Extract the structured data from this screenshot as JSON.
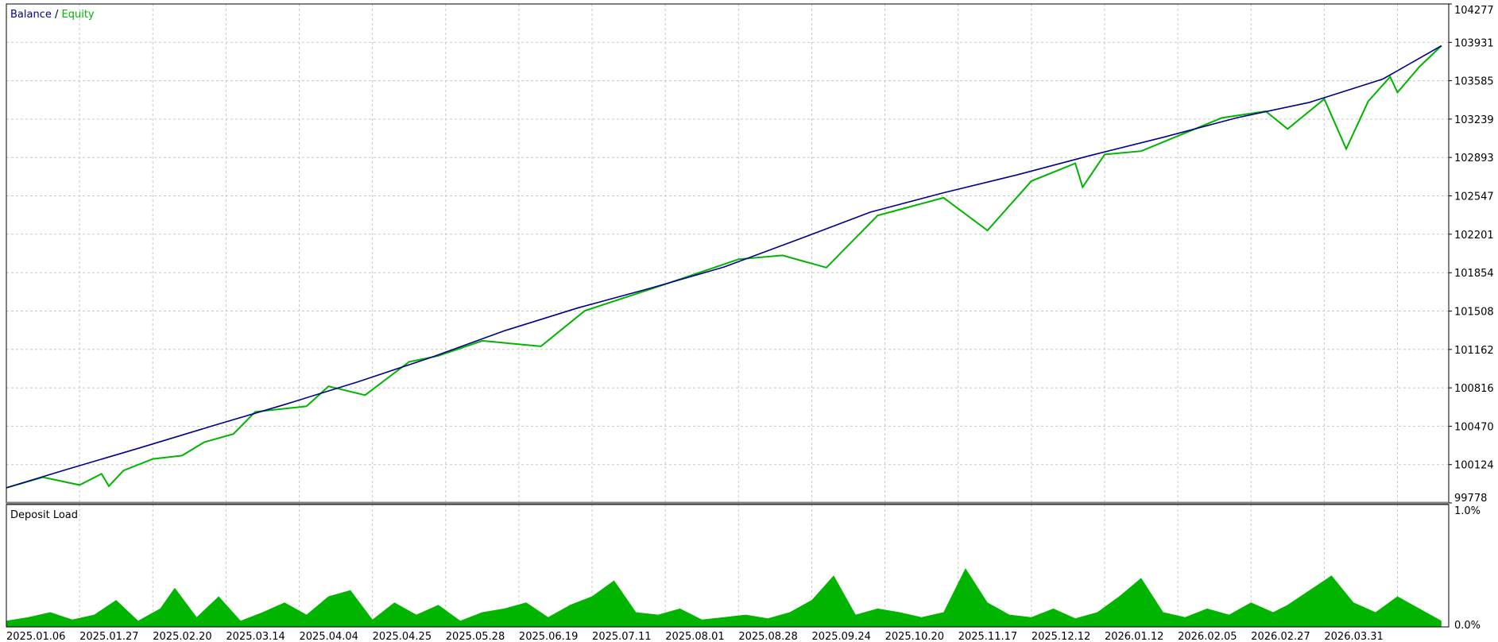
{
  "legend": {
    "balance_label": "Balance",
    "separator": " / ",
    "equity_label": "Equity"
  },
  "sub_title": "Deposit Load",
  "colors": {
    "balance": "#00008b",
    "equity": "#00b400",
    "load_fill": "#00b400",
    "grid": "#c8c8c8",
    "frame": "#000000",
    "divider": "#808080",
    "background": "#ffffff",
    "text": "#000000"
  },
  "chart_data": [
    {
      "type": "line",
      "name": "balance-equity",
      "series": [
        {
          "name": "Balance",
          "color": "#00008b",
          "x": [
            0,
            8,
            18,
            28,
            38,
            48,
            58,
            68,
            78,
            88,
            98,
            108,
            118,
            128,
            138,
            148,
            158,
            168,
            178,
            188,
            196
          ],
          "values": [
            99915,
            100075,
            100270,
            100470,
            100665,
            100870,
            101090,
            101330,
            101535,
            101715,
            101905,
            102150,
            102400,
            102575,
            102735,
            102910,
            103075,
            103250,
            103390,
            103600,
            103900
          ]
        },
        {
          "name": "Equity",
          "color": "#00b400",
          "x": [
            0,
            5,
            10,
            13,
            14,
            16,
            20,
            24,
            27,
            31,
            34,
            41,
            44,
            49,
            55,
            59,
            65,
            73,
            79,
            90,
            100,
            106,
            112,
            119,
            128,
            134,
            140,
            146,
            147,
            150,
            155,
            166,
            172,
            175,
            180,
            183,
            186,
            189,
            190,
            193,
            196
          ],
          "values": [
            99915,
            100010,
            99940,
            100040,
            99930,
            100070,
            100175,
            100205,
            100325,
            100400,
            100600,
            100650,
            100830,
            100750,
            101050,
            101105,
            101240,
            101190,
            101510,
            101750,
            101975,
            102010,
            101900,
            102370,
            102530,
            102235,
            102680,
            102840,
            102625,
            102920,
            102950,
            103250,
            103310,
            103150,
            103420,
            102970,
            103400,
            103620,
            103480,
            103710,
            103900
          ]
        }
      ],
      "ylim": [
        99778,
        104277
      ],
      "yticks": [
        104277,
        103931,
        103585,
        103239,
        102893,
        102547,
        102201,
        101854,
        101508,
        101162,
        100816,
        100470,
        100124,
        99778
      ],
      "ytick_labels": [
        "104277",
        "103931",
        "103585",
        "103239",
        "102893",
        "102547",
        "102201",
        "101854",
        "101508",
        "101162",
        "100816",
        "100470",
        "100124",
        "99778"
      ],
      "xlim": [
        0,
        197
      ],
      "xticks": [
        0,
        10,
        20,
        30,
        40,
        50,
        60,
        70,
        80,
        90,
        100,
        110,
        120,
        130,
        140,
        150,
        160,
        170,
        180,
        190
      ],
      "xtick_labels": [
        "2025.01.06",
        "2025.01.27",
        "2025.02.20",
        "2025.03.14",
        "2025.04.04",
        "2025.04.25",
        "2025.05.28",
        "2025.06.19",
        "2025.07.11",
        "2025.08.01",
        "2025.08.28",
        "2025.09.24",
        "2025.10.20",
        "2025.11.17",
        "2025.12.12",
        "2026.01.12",
        "2026.02.05",
        "2026.02.27",
        "2026.03.31",
        ""
      ],
      "grid": true,
      "legend_position": "top-left"
    },
    {
      "type": "area",
      "name": "deposit-load",
      "series": [
        {
          "name": "Deposit Load",
          "color": "#00b400",
          "x": [
            0,
            3,
            6,
            9,
            12,
            15,
            18,
            21,
            23,
            26,
            29,
            32,
            35,
            38,
            41,
            44,
            47,
            50,
            53,
            56,
            59,
            62,
            65,
            68,
            71,
            74,
            77,
            80,
            83,
            86,
            89,
            92,
            95,
            98,
            101,
            104,
            107,
            110,
            113,
            116,
            119,
            122,
            125,
            128,
            131,
            134,
            137,
            140,
            143,
            146,
            149,
            152,
            155,
            158,
            161,
            164,
            167,
            170,
            173,
            175,
            178,
            181,
            184,
            187,
            190,
            193,
            196
          ],
          "values": [
            0.05,
            0.08,
            0.12,
            0.06,
            0.1,
            0.22,
            0.05,
            0.15,
            0.32,
            0.08,
            0.25,
            0.05,
            0.12,
            0.2,
            0.1,
            0.25,
            0.3,
            0.06,
            0.2,
            0.1,
            0.18,
            0.05,
            0.12,
            0.15,
            0.2,
            0.08,
            0.18,
            0.25,
            0.38,
            0.12,
            0.1,
            0.15,
            0.06,
            0.08,
            0.1,
            0.07,
            0.12,
            0.22,
            0.42,
            0.1,
            0.15,
            0.12,
            0.08,
            0.12,
            0.48,
            0.2,
            0.1,
            0.08,
            0.15,
            0.07,
            0.12,
            0.25,
            0.4,
            0.12,
            0.08,
            0.15,
            0.1,
            0.2,
            0.12,
            0.18,
            0.3,
            0.42,
            0.2,
            0.12,
            0.25,
            0.15,
            0.05
          ]
        }
      ],
      "ylim": [
        0,
        1.0
      ],
      "ytick_labels": [
        "1.0%",
        "0.0%"
      ],
      "xlim": [
        0,
        197
      ]
    }
  ]
}
